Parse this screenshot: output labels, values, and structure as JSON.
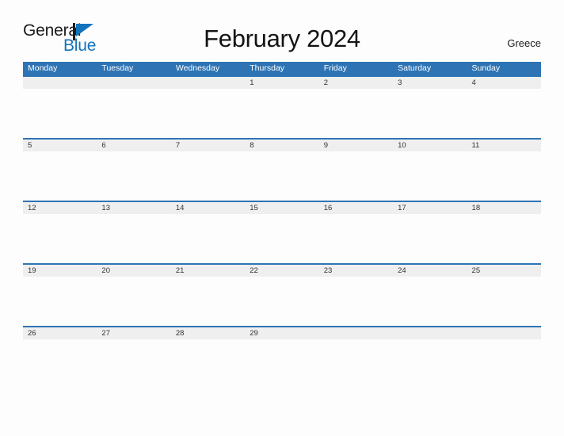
{
  "brand": {
    "name_part1": "General",
    "name_part2": "Blue",
    "flag_icon": "blue-triangle-flag-icon",
    "color_dark": "#1c1c1c",
    "color_blue": "#1273bd"
  },
  "header": {
    "title": "February 2024",
    "country": "Greece"
  },
  "theme": {
    "header_blue": "#2e74b5",
    "band_gray": "#efefef",
    "page_background": "#fdfdfd",
    "date_text": "#333333"
  },
  "calendar": {
    "month": "February",
    "year": "2024",
    "weekday_headers": [
      "Monday",
      "Tuesday",
      "Wednesday",
      "Thursday",
      "Friday",
      "Saturday",
      "Sunday"
    ],
    "weeks": [
      [
        "",
        "",
        "",
        "1",
        "2",
        "3",
        "4"
      ],
      [
        "5",
        "6",
        "7",
        "8",
        "9",
        "10",
        "11"
      ],
      [
        "12",
        "13",
        "14",
        "15",
        "16",
        "17",
        "18"
      ],
      [
        "19",
        "20",
        "21",
        "22",
        "23",
        "24",
        "25"
      ],
      [
        "26",
        "27",
        "28",
        "29",
        "",
        "",
        ""
      ]
    ]
  }
}
